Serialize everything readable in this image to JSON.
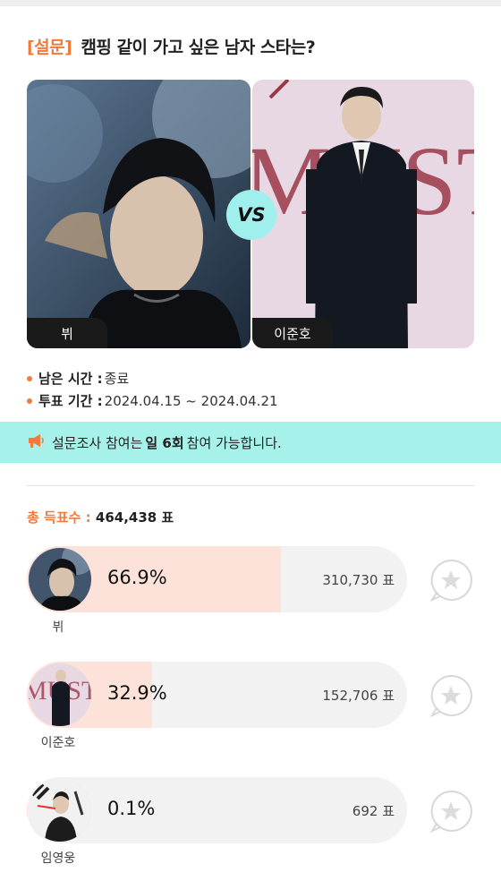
{
  "poll": {
    "tag": "[설문]",
    "title": "캠핑 같이 가고 싶은 남자 스타는?"
  },
  "matchup": {
    "left_name": "뷔",
    "right_name": "이준호",
    "vs_label": "VS"
  },
  "info": {
    "remaining_label": "남은 시간 :",
    "remaining_value": "종료",
    "period_label": "투표 기간 :",
    "period_value": "2024.04.15 ~ 2024.04.21"
  },
  "notice": {
    "pre": "설문조사 참여는",
    "bold": "일 6회",
    "post": "참여 가능합니다.",
    "icon": "megaphone-icon"
  },
  "total": {
    "label": "총 득표수 :",
    "value": "464,438 표"
  },
  "candidates": [
    {
      "name": "뷔",
      "percent_label": "66.9%",
      "percent": 66.9,
      "votes": "310,730 표"
    },
    {
      "name": "이준호",
      "percent_label": "32.9%",
      "percent": 32.9,
      "votes": "152,706 표"
    },
    {
      "name": "임영웅",
      "percent_label": "0.1%",
      "percent": 0.1,
      "votes": "692 표"
    }
  ],
  "colors": {
    "accent": "#f27a3f",
    "notice_bg": "#a6f1ea",
    "vs_bg": "#9ff0ec",
    "bar_fill": "#fde2d9",
    "bar_track": "#f2f2f2"
  }
}
